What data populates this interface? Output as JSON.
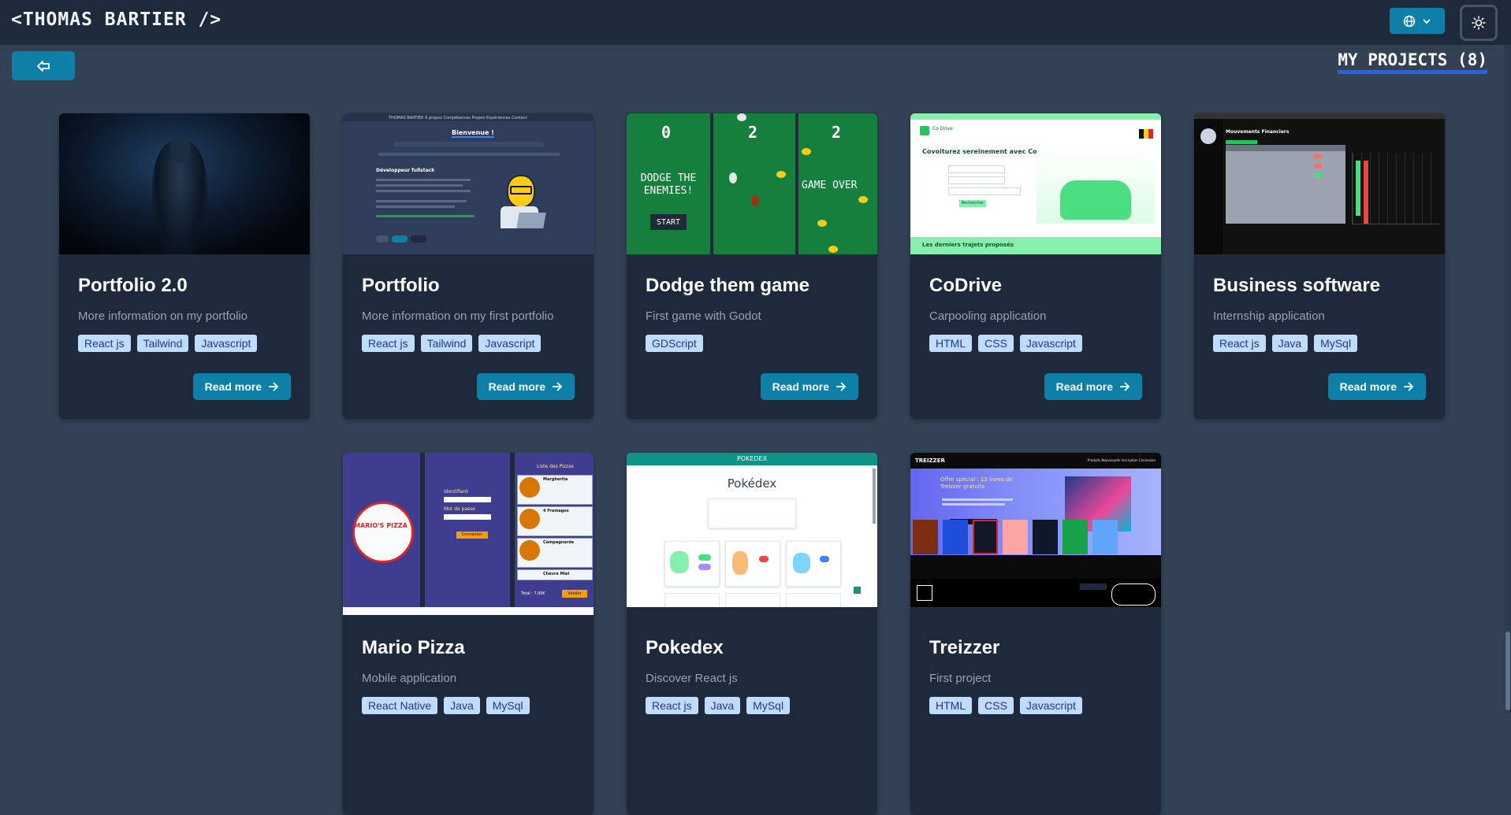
{
  "header": {
    "brand": "<THOMAS BARTIER />",
    "language_icon": "globe-icon",
    "theme_icon": "sun-icon"
  },
  "nav": {
    "back_icon": "back-arrow-icon"
  },
  "page": {
    "title": "MY PROJECTS (8)"
  },
  "colors": {
    "accent": "#0e7fa6",
    "underline": "#2563eb",
    "tag_bg": "#bfdbfe",
    "card_bg": "#1e293b",
    "page_bg": "#334155"
  },
  "projects": [
    {
      "title": "Portfolio 2.0",
      "description": "More information on my portfolio",
      "tags": [
        "React js",
        "Tailwind",
        "Javascript"
      ],
      "button": "Read more"
    },
    {
      "title": "Portfolio",
      "description": "More information on my first portfolio",
      "tags": [
        "React js",
        "Tailwind",
        "Javascript"
      ],
      "button": "Read more",
      "thumb": {
        "nav": "THOMAS BARTIER  À propos  Compétences  Projets  Expériences  Contact",
        "heading": "Bienvenue !",
        "subheading": "Développeur fullstack"
      }
    },
    {
      "title": "Dodge them game",
      "description": "First game with Godot",
      "tags": [
        "GDScript"
      ],
      "button": "Read more",
      "thumb": {
        "score1": "0",
        "score2": "2",
        "score3": "2",
        "title_text": "DODGE THE ENEMIES!",
        "start": "START",
        "gameover": "GAME OVER"
      }
    },
    {
      "title": "CoDrive",
      "description": "Carpooling application",
      "tags": [
        "HTML",
        "CSS",
        "Javascript"
      ],
      "button": "Read more",
      "thumb": {
        "logo": "Co Drive",
        "headline": "Covoiturez sereinement avec CoDrive",
        "cta": "Rechercher",
        "footer": "Les derniers trajets proposés"
      }
    },
    {
      "title": "Business software",
      "description": "Internship application",
      "tags": [
        "React js",
        "Java",
        "MySql"
      ],
      "button": "Read more",
      "thumb": {
        "heading": "Mouvements Financiers"
      }
    },
    {
      "title": "Mario Pizza",
      "description": "Mobile application",
      "tags": [
        "React Native",
        "Java",
        "MySql"
      ],
      "thumb": {
        "logo": "MARIO'S PIZZA",
        "login_title": "Identifiant",
        "password_title": "Mot de passe",
        "connect": "Connexion",
        "list_title": "Liste des Pizzas",
        "pizzas": [
          "Margherita",
          "4 Fromages",
          "Campagnarde",
          "Chèvre Miel"
        ],
        "total": "Total : 7,90€",
        "validate": "Valider"
      }
    },
    {
      "title": "Pokedex",
      "description": "Discover React js",
      "tags": [
        "React js",
        "Java",
        "MySql"
      ],
      "thumb": {
        "bar": "POKEDEX",
        "heading": "Pokédex"
      }
    },
    {
      "title": "Treizzer",
      "description": "First project",
      "tags": [
        "HTML",
        "CSS",
        "Javascript"
      ],
      "thumb": {
        "logo": "TREIZZER",
        "nav": "Produits  Nouveautés  Inscription  Connexion",
        "offer": "Offre spécial : 13 livres de Treizzer gratuits"
      }
    }
  ]
}
